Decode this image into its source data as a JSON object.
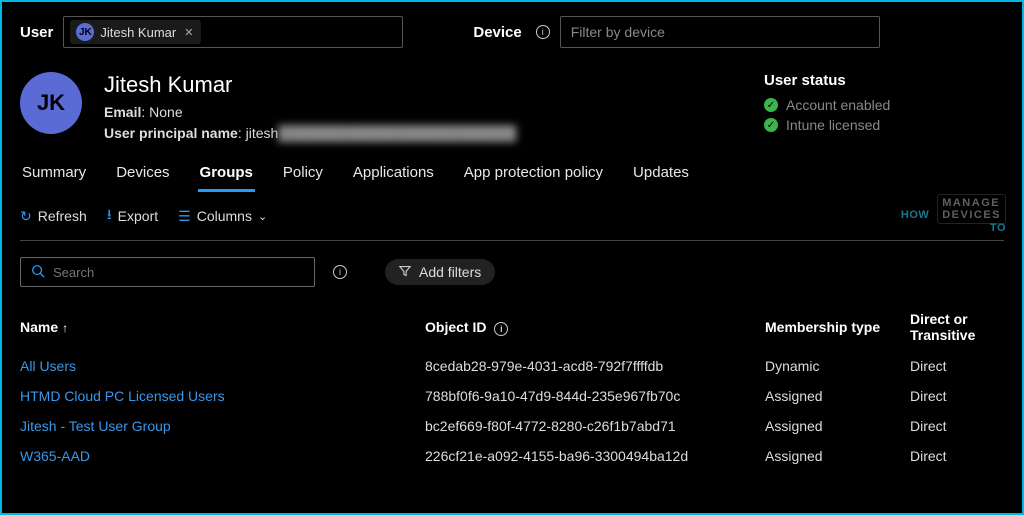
{
  "topbar": {
    "user_label": "User",
    "chip_initials": "JK",
    "chip_name": "Jitesh Kumar",
    "device_label": "Device",
    "device_placeholder": "Filter by device"
  },
  "header": {
    "avatar_initials": "JK",
    "name": "Jitesh Kumar",
    "email_label": "Email",
    "email_value": "None",
    "upn_label": "User principal name",
    "upn_partial": "jitesh",
    "upn_redacted": "████████████████████████"
  },
  "status": {
    "title": "User status",
    "items": [
      "Account enabled",
      "Intune licensed"
    ]
  },
  "tabs": [
    "Summary",
    "Devices",
    "Groups",
    "Policy",
    "Applications",
    "App protection policy",
    "Updates"
  ],
  "active_tab": "Groups",
  "toolbar": {
    "refresh": "Refresh",
    "export": "Export",
    "columns": "Columns"
  },
  "watermark": {
    "how": "HOW",
    "to": "TO",
    "md1": "MANAGE",
    "md2": "DEVICES"
  },
  "search": {
    "placeholder": "Search",
    "add_filters": "Add filters"
  },
  "columns": {
    "name": "Name",
    "object_id": "Object ID",
    "membership": "Membership type",
    "direct": "Direct or Transitive"
  },
  "rows": [
    {
      "name": "All Users",
      "object_id": "8cedab28-979e-4031-acd8-792f7ffffdb",
      "membership": "Dynamic",
      "direct": "Direct"
    },
    {
      "name": "HTMD Cloud PC Licensed Users",
      "object_id": "788bf0f6-9a10-47d9-844d-235e967fb70c",
      "membership": "Assigned",
      "direct": "Direct"
    },
    {
      "name": "Jitesh - Test User Group",
      "object_id": "bc2ef669-f80f-4772-8280-c26f1b7abd71",
      "membership": "Assigned",
      "direct": "Direct"
    },
    {
      "name": "W365-AAD",
      "object_id": "226cf21e-a092-4155-ba96-3300494ba12d",
      "membership": "Assigned",
      "direct": "Direct"
    }
  ]
}
